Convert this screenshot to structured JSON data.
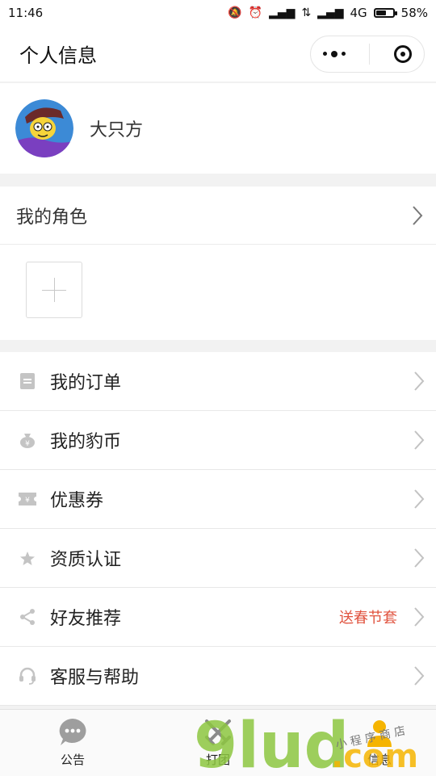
{
  "status_bar": {
    "time": "11:46",
    "network": "4G",
    "battery": "58%",
    "battery_level": 0.58
  },
  "nav": {
    "title": "个人信息"
  },
  "profile": {
    "username": "大只方"
  },
  "roles": {
    "title": "我的角色"
  },
  "menu": [
    {
      "label": "我的订单",
      "icon": "order-icon"
    },
    {
      "label": "我的豹币",
      "icon": "coin-bag-icon"
    },
    {
      "label": "优惠券",
      "icon": "coupon-icon"
    },
    {
      "label": "资质认证",
      "icon": "certificate-icon"
    },
    {
      "label": "好友推荐",
      "icon": "share-icon",
      "extra": "送春节套"
    },
    {
      "label": "客服与帮助",
      "icon": "headset-icon"
    }
  ],
  "tabbar": [
    {
      "label": "公告",
      "icon": "chat-bubble-icon"
    },
    {
      "label": "打团",
      "icon": "swords-icon"
    },
    {
      "label": "信息",
      "icon": "person-icon"
    }
  ],
  "watermark": {
    "brand": "9lud.com",
    "tagline": "小程序商店"
  },
  "colors": {
    "accent_red": "#e0533f",
    "watermark_green": "#8cc63f",
    "watermark_yellow": "#f5b400"
  }
}
